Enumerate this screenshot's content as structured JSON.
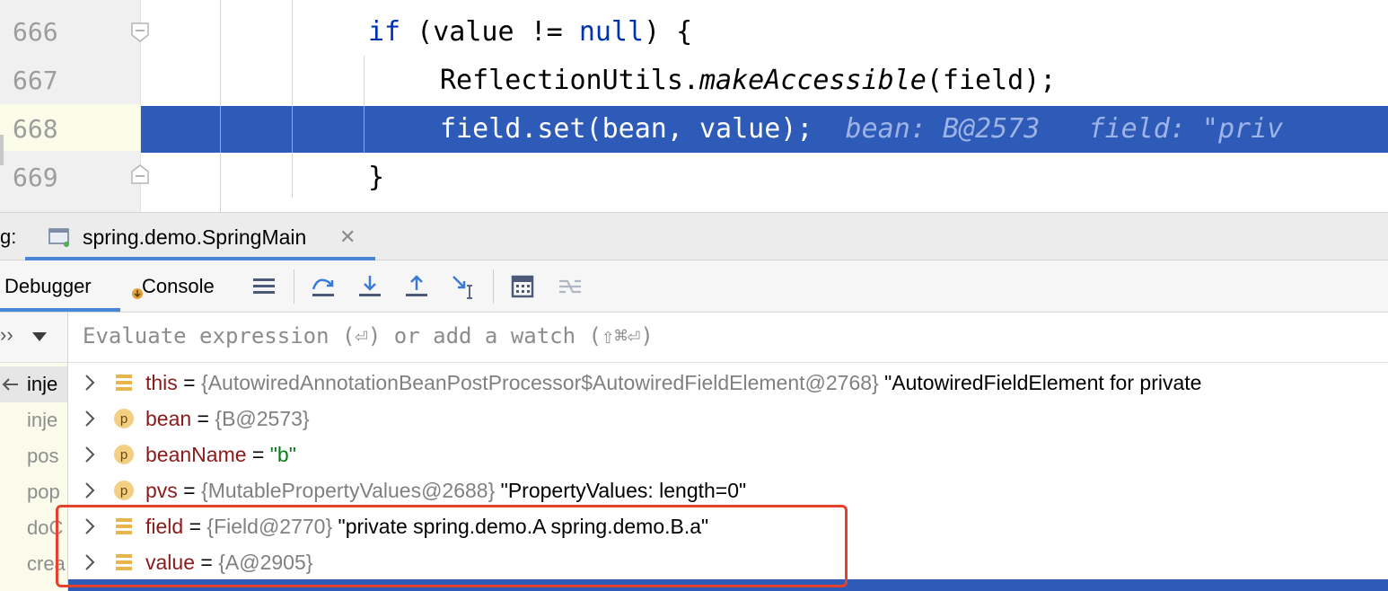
{
  "editor": {
    "lines": [
      {
        "number": "666",
        "tokens": [
          {
            "t": "if",
            "c": "kw"
          },
          {
            "t": " (value != "
          },
          {
            "t": "null",
            "c": "kw"
          },
          {
            "t": ") {"
          }
        ]
      },
      {
        "number": "667",
        "tokens": [
          {
            "t": "ReflectionUtils."
          },
          {
            "t": "makeAccessible",
            "c": "it"
          },
          {
            "t": "(field);"
          }
        ]
      },
      {
        "number": "668",
        "tokens": [
          {
            "t": "field.set(bean, value);"
          },
          {
            "t": "  bean: B@2573   field: \"priv",
            "c": "inlay"
          }
        ]
      },
      {
        "number": "669",
        "tokens": [
          {
            "t": "}"
          }
        ]
      }
    ]
  },
  "debug": {
    "prefix": "g:",
    "session_tab": "spring.demo.SpringMain",
    "tabs": {
      "debugger": "Debugger",
      "console": "Console"
    }
  },
  "evaluate": {
    "placeholder": "Evaluate expression (⏎) or add a watch (⇧⌘⏎)"
  },
  "frames": [
    "inje",
    "inje",
    "pos",
    "pop",
    "doC",
    "crea",
    "—"
  ],
  "variables": [
    {
      "icon": "field-icon",
      "name": "this",
      "value": "{AutowiredAnnotationBeanPostProcessor$AutowiredFieldElement@2768}",
      "desc": "\"AutowiredFieldElement for private"
    },
    {
      "icon": "param-icon",
      "name": "bean",
      "value": "{B@2573}",
      "desc": ""
    },
    {
      "icon": "param-icon",
      "name": "beanName",
      "value": "",
      "desc": "\"b\""
    },
    {
      "icon": "param-icon",
      "name": "pvs",
      "value": "{MutablePropertyValues@2688}",
      "desc": "\"PropertyValues: length=0\""
    },
    {
      "icon": "field-icon",
      "name": "field",
      "value": "{Field@2770}",
      "desc": "\"private spring.demo.A spring.demo.B.a\""
    },
    {
      "icon": "field-icon",
      "name": "value",
      "value": "{A@2905}",
      "desc": ""
    }
  ],
  "colors": {
    "selection": "#2e5bb8",
    "highlight_box": "#e4422c",
    "keyword": "#0033b3"
  }
}
